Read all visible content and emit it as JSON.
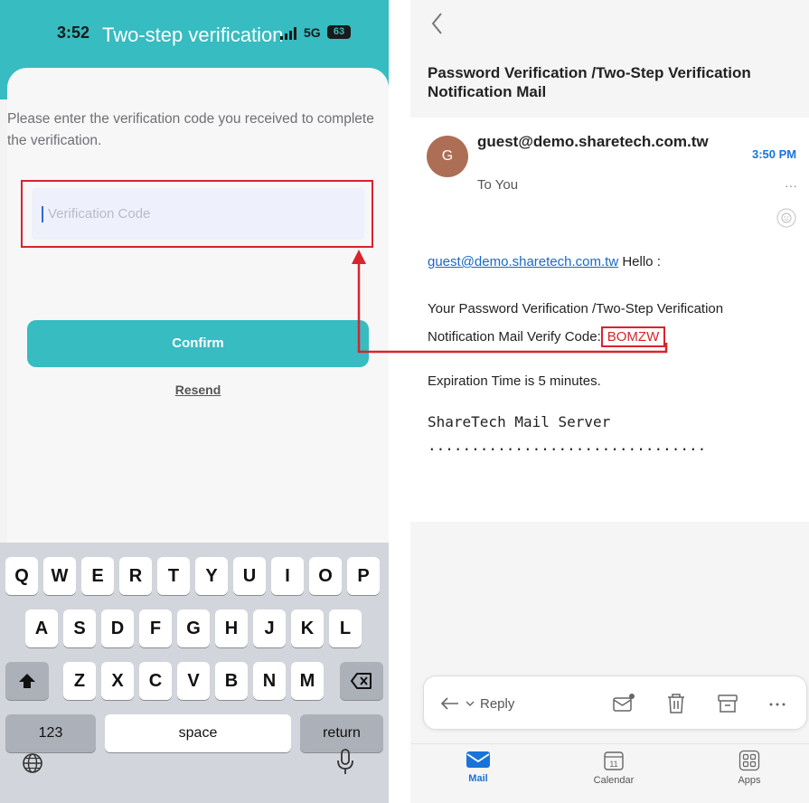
{
  "left_phone": {
    "status_time": "3:52",
    "title": "Two-step verification",
    "network": "5G",
    "battery": "63",
    "instruction": "Please enter the verification code you received to complete the verification.",
    "code_placeholder": "Verification Code",
    "confirm_label": "Confirm",
    "resend_label": "Resend",
    "keyboard": {
      "row1": [
        "Q",
        "W",
        "E",
        "R",
        "T",
        "Y",
        "U",
        "I",
        "O",
        "P"
      ],
      "row2": [
        "A",
        "S",
        "D",
        "F",
        "G",
        "H",
        "J",
        "K",
        "L"
      ],
      "row3": [
        "Z",
        "X",
        "C",
        "V",
        "B",
        "N",
        "M"
      ],
      "numbers_key": "123",
      "space_key": "space",
      "return_key": "return"
    }
  },
  "right_phone": {
    "subject": "Password Verification /Two-Step Verification Notification Mail",
    "sender_initial": "G",
    "sender": "guest@demo.sharetech.com.tw",
    "recipient": "To You",
    "time": "3:50 PM",
    "more_dots": "···",
    "body": {
      "greeting_link": "guest@demo.sharetech.com.tw",
      "greeting_rest": " Hello :",
      "line1": "Your  Password Verification /Two-Step Verification",
      "line2_prefix": "Notification Mail Verify Code:",
      "verify_code": "BOMZW",
      "expiration": "Expiration Time is 5 minutes.",
      "signature": "ShareTech Mail Server",
      "signature_dots": "................................"
    },
    "reply_label": "Reply",
    "tabs": [
      {
        "label": "Mail",
        "active": true
      },
      {
        "label": "Calendar",
        "active": false
      },
      {
        "label": "Apps",
        "active": false
      }
    ],
    "calendar_day": "11"
  },
  "colors": {
    "teal": "#36bcc1",
    "highlight_red": "#d9232d",
    "link_blue": "#1a68c7",
    "accent_blue": "#1a73d8"
  }
}
